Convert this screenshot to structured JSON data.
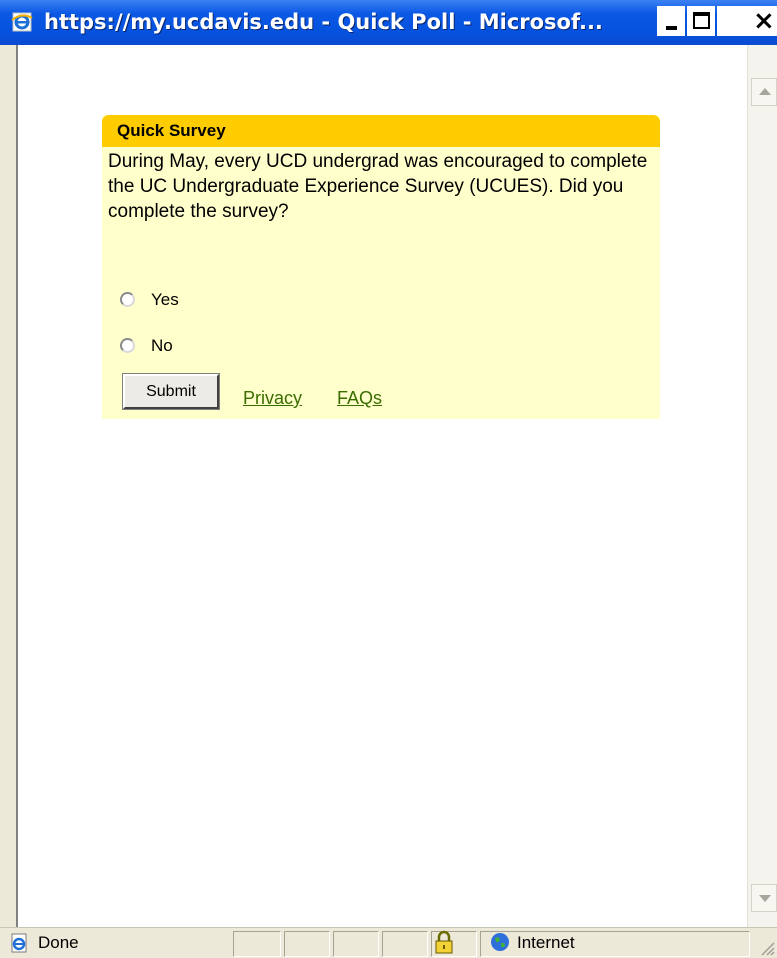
{
  "window": {
    "title": "https://my.ucdavis.edu - Quick Poll - Microsof...",
    "minimize_glyph": "_",
    "maximize_glyph": "□",
    "close_glyph": "×"
  },
  "survey": {
    "header": "Quick Survey",
    "question": "During May, every UCD undergrad was encouraged to complete the UC Undergraduate Experience Survey (UCUES). Did you complete the survey?",
    "options": [
      {
        "label": "Yes",
        "selected": false
      },
      {
        "label": "No",
        "selected": false
      }
    ],
    "submit_label": "Submit",
    "links": [
      "Privacy",
      "FAQs"
    ],
    "header_color": "#ffcc00",
    "body_color": "#ffffcc",
    "link_color": "#3a6d00"
  },
  "statusbar": {
    "status": "Done",
    "zone": "Internet",
    "icons": [
      "ie-page-icon",
      "lock-icon",
      "globe-icon"
    ]
  }
}
